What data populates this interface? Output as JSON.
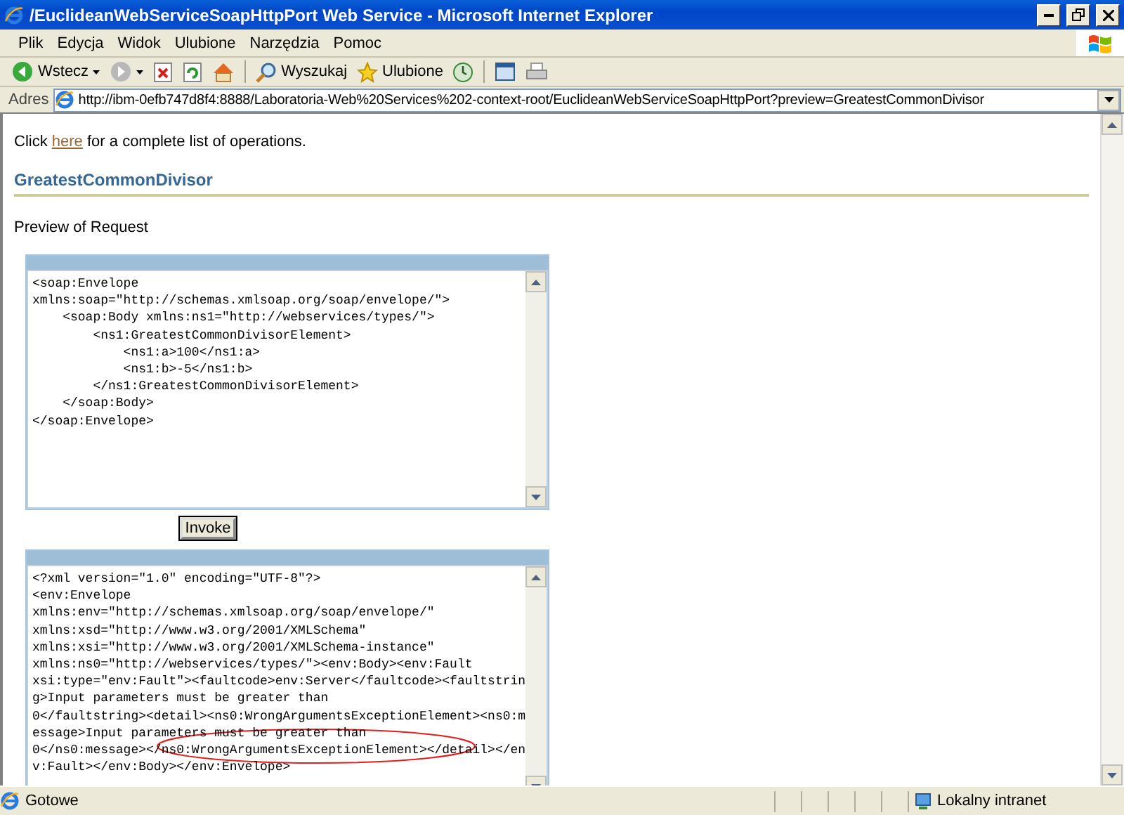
{
  "window": {
    "title": "/EuclideanWebServiceSoapHttpPort Web Service - Microsoft Internet Explorer"
  },
  "menu": [
    "Plik",
    "Edycja",
    "Widok",
    "Ulubione",
    "Narzędzia",
    "Pomoc"
  ],
  "toolbar": [
    {
      "kind": "back",
      "label": "Wstecz"
    },
    {
      "kind": "forward"
    },
    {
      "kind": "stop"
    },
    {
      "kind": "refresh"
    },
    {
      "kind": "home"
    },
    {
      "kind": "search",
      "label": "Wyszukaj"
    },
    {
      "kind": "favorites",
      "label": "Ulubione"
    },
    {
      "kind": "history"
    },
    {
      "kind": "window"
    },
    {
      "kind": "print"
    }
  ],
  "address": {
    "label": "Adres",
    "url": "http://ibm-0efb747d8f4:8888/Laboratoria-Web%20Services%202-context-root/EuclideanWebServiceSoapHttpPort?preview=GreatestCommonDivisor"
  },
  "page": {
    "intro_before": "Click",
    "link": "here",
    "intro_after": "for a complete list of operations.",
    "heading": "GreatestCommonDivisor",
    "preview_label": "Preview of Request",
    "request_lines": [
      "<soap:Envelope",
      "xmlns:soap=\"http://schemas.xmlsoap.org/soap/envelope/\">",
      "    <soap:Body xmlns:ns1=\"http://webservices/types/\">",
      "        <ns1:GreatestCommonDivisorElement>",
      "            <ns1:a>100</ns1:a>",
      "            <ns1:b>-5</ns1:b>",
      "        </ns1:GreatestCommonDivisorElement>",
      "    </soap:Body>",
      "</soap:Envelope>"
    ],
    "invoke_button": "Invoke",
    "response_lines": [
      "<?xml version=\"1.0\" encoding=\"UTF-8\"?>",
      "<env:Envelope",
      "xmlns:env=\"http://schemas.xmlsoap.org/soap/envelope/\"",
      "xmlns:xsd=\"http://www.w3.org/2001/XMLSchema\"",
      "xmlns:xsi=\"http://www.w3.org/2001/XMLSchema-instance\"",
      "xmlns:ns0=\"http://webservices/types/\"><env:Body><env:Fault",
      "xsi:type=\"env:Fault\"><faultcode>env:Server</faultcode><faultstrin",
      "g>Input parameters must be greater than",
      "0</faultstring><detail><ns0:WrongArgumentsExceptionElement><ns0:m",
      "essage>Input parameters must be greater than",
      "0</ns0:message></ns0:WrongArgumentsExceptionElement></detail></en",
      "v:Fault></env:Body></env:Envelope>"
    ]
  },
  "status": {
    "text": "Gotowe",
    "zone": "Lokalny intranet"
  }
}
